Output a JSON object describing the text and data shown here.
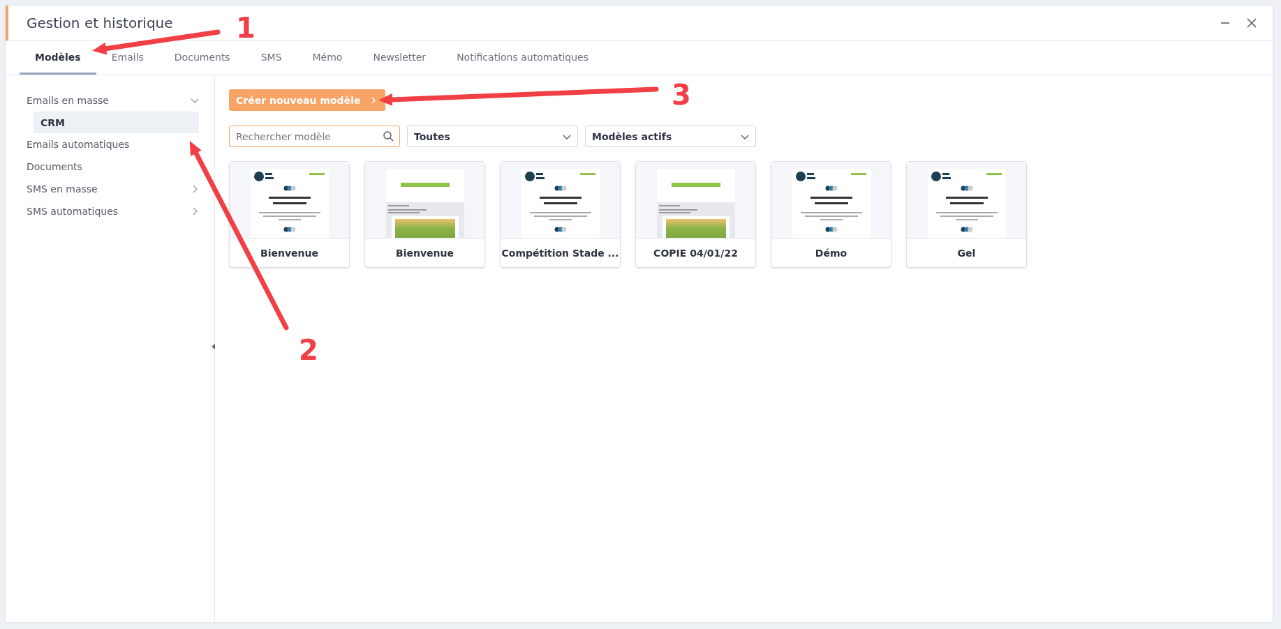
{
  "window": {
    "title": "Gestion et historique"
  },
  "tabs": [
    {
      "label": "Modèles",
      "selected": true
    },
    {
      "label": "Emails",
      "selected": false
    },
    {
      "label": "Documents",
      "selected": false
    },
    {
      "label": "SMS",
      "selected": false
    },
    {
      "label": "Mémo",
      "selected": false
    },
    {
      "label": "Newsletter",
      "selected": false
    },
    {
      "label": "Notifications automatiques",
      "selected": false
    }
  ],
  "sidebar": {
    "items": [
      {
        "label": "Emails en masse",
        "expanded": true,
        "selected": false,
        "children": [
          {
            "label": "CRM",
            "selected": true
          }
        ]
      },
      {
        "label": "Emails automatiques",
        "selected": false
      },
      {
        "label": "Documents",
        "selected": false
      },
      {
        "label": "SMS en masse",
        "expanded": false,
        "selected": false
      },
      {
        "label": "SMS automatiques",
        "expanded": false,
        "selected": false
      }
    ]
  },
  "create_button": {
    "label": "Créer nouveau modèle"
  },
  "filters": {
    "search": {
      "placeholder": "Rechercher modèle"
    },
    "category": {
      "value": "Toutes"
    },
    "status": {
      "value": "Modèles actifs"
    }
  },
  "templates": [
    {
      "name": "Bienvenue",
      "kind": "welcome"
    },
    {
      "name": "Bienvenue",
      "kind": "photo"
    },
    {
      "name": "Compétition Stade ...",
      "kind": "welcome"
    },
    {
      "name": "COPIE 04/01/22",
      "kind": "photo"
    },
    {
      "name": "Démo",
      "kind": "welcome"
    },
    {
      "name": "Gel",
      "kind": "welcome"
    }
  ],
  "annotations": [
    {
      "label": "1"
    },
    {
      "label": "2"
    },
    {
      "label": "3"
    }
  ]
}
